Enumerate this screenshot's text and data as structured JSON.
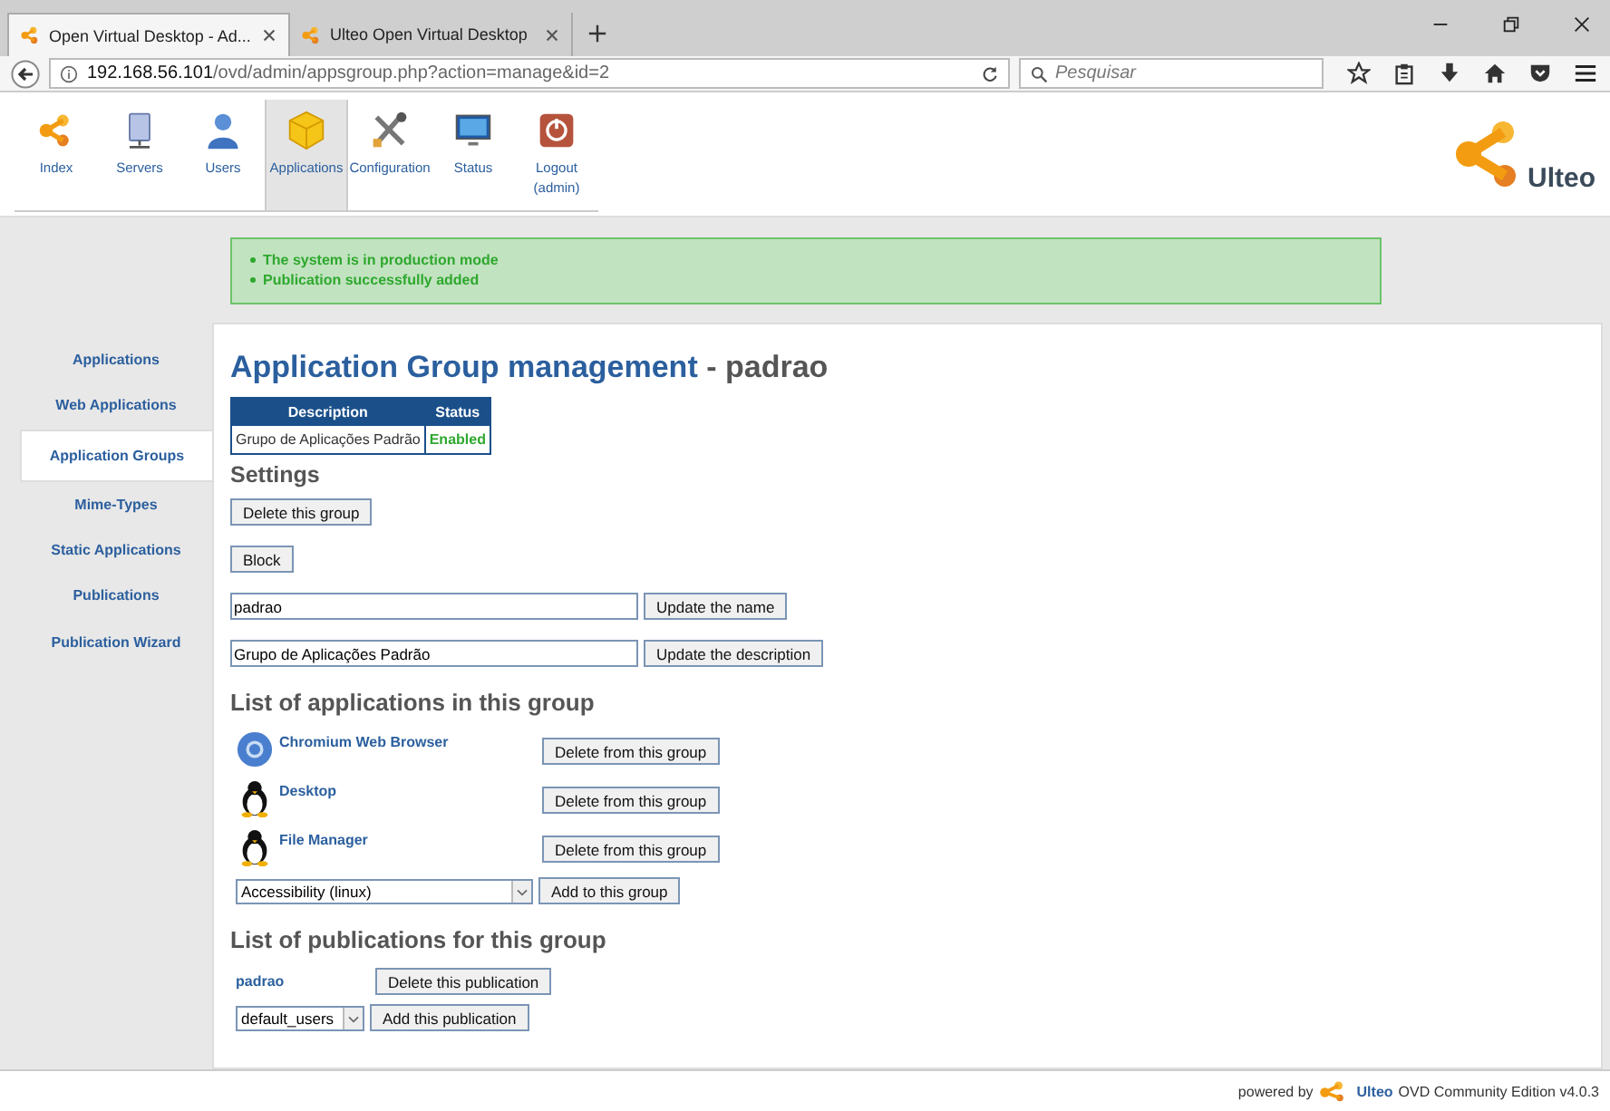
{
  "browser": {
    "tabs": [
      {
        "title": "Open Virtual Desktop - Ad...",
        "selected": true
      },
      {
        "title": "Ulteo Open Virtual Desktop",
        "selected": false
      }
    ],
    "url": {
      "host": "192.168.56.101",
      "path": "/ovd/admin/appsgroup.php?action=manage&id=2"
    },
    "search": {
      "placeholder": "Pesquisar"
    }
  },
  "nav": {
    "items": [
      {
        "label": "Index",
        "selected": false
      },
      {
        "label": "Servers",
        "selected": false
      },
      {
        "label": "Users",
        "selected": false
      },
      {
        "label": "Applications",
        "selected": true
      },
      {
        "label": "Configuration",
        "selected": false
      },
      {
        "label": "Status",
        "selected": false
      },
      {
        "label": "Logout",
        "sublabel": "(admin)",
        "selected": false
      }
    ]
  },
  "logo": {
    "text": "Ulteo"
  },
  "messages": [
    "The system is in production mode",
    "Publication successfully added"
  ],
  "sidebar": {
    "items": [
      {
        "label": "Applications",
        "selected": false
      },
      {
        "label": "Web Applications",
        "selected": false
      },
      {
        "label": "Application Groups",
        "selected": true
      },
      {
        "label": "Mime-Types",
        "selected": false
      },
      {
        "label": "Static Applications",
        "selected": false
      },
      {
        "label": "Publications",
        "selected": false
      },
      {
        "label": "Publication Wizard",
        "selected": false
      }
    ]
  },
  "content": {
    "title": "Application Group management",
    "title_suffix": "- padrao",
    "group_table": {
      "columns": [
        "Description",
        "Status"
      ],
      "row": [
        "Grupo de Aplicações Padrão",
        "Enabled"
      ]
    },
    "settings": {
      "heading": "Settings",
      "delete_button": "Delete this group",
      "block_button": "Block",
      "name_field": {
        "value": "padrao",
        "button": "Update the name"
      },
      "description_field": {
        "value": "Grupo de Aplicações Padrão",
        "button": "Update the description"
      }
    },
    "applications": {
      "heading": "List of applications in this group",
      "items": [
        {
          "name": "Chromium Web Browser",
          "kind": "browser",
          "button": "Delete from this group"
        },
        {
          "name": "Desktop",
          "kind": "linux",
          "button": "Delete from this group"
        },
        {
          "name": "File Manager",
          "kind": "linux",
          "button": "Delete from this group"
        }
      ],
      "add_select": "Accessibility (linux)",
      "add_button": "Add to this group"
    },
    "publications": {
      "heading": "List of publications for this group",
      "items": [
        {
          "name": "padrao",
          "button": "Delete this publication"
        }
      ],
      "add_select": "default_users",
      "add_button": "Add this publication"
    }
  },
  "footer": {
    "prefix": "powered by",
    "brand": "Ulteo",
    "suffix": "OVD Community Edition v4.0.3"
  }
}
